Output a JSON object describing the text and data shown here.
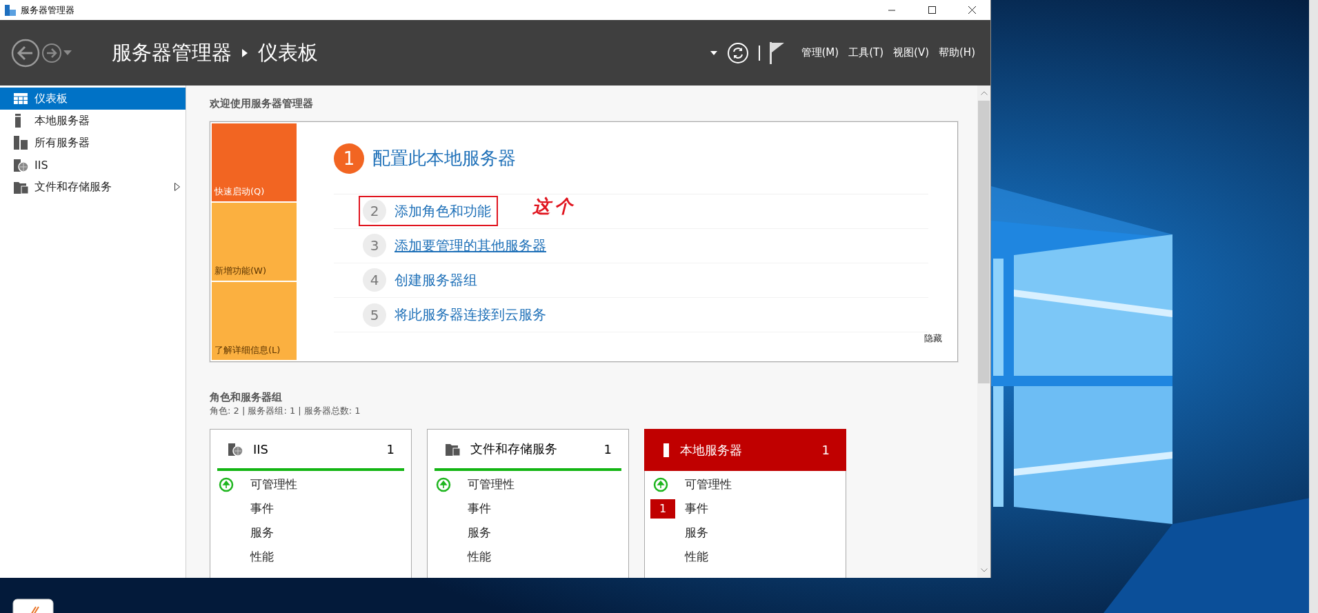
{
  "window": {
    "title": "服务器管理器"
  },
  "header": {
    "breadcrumb": [
      "服务器管理器",
      "仪表板"
    ],
    "menus": [
      "管理(M)",
      "工具(T)",
      "视图(V)",
      "帮助(H)"
    ]
  },
  "sidebar": {
    "items": [
      {
        "label": "仪表板",
        "kind": "dashboard",
        "selected": true,
        "has_children": false
      },
      {
        "label": "本地服务器",
        "kind": "server",
        "selected": false,
        "has_children": false
      },
      {
        "label": "所有服务器",
        "kind": "servers",
        "selected": false,
        "has_children": false
      },
      {
        "label": "IIS",
        "kind": "iis",
        "selected": false,
        "has_children": false
      },
      {
        "label": "文件和存储服务",
        "kind": "files",
        "selected": false,
        "has_children": true
      }
    ]
  },
  "welcome": {
    "heading": "欢迎使用服务器管理器",
    "tiles": [
      {
        "label": "快速启动(Q)",
        "selected": true
      },
      {
        "label": "新增功能(W)",
        "selected": false
      },
      {
        "label": "了解详细信息(L)",
        "selected": false
      }
    ],
    "step": {
      "number": "1",
      "title": "配置此本地服务器"
    },
    "tasks": [
      {
        "number": "2",
        "label": "添加角色和功能",
        "highlighted": true,
        "hovered": false
      },
      {
        "number": "3",
        "label": "添加要管理的其他服务器",
        "highlighted": false,
        "hovered": true
      },
      {
        "number": "4",
        "label": "创建服务器组",
        "highlighted": false,
        "hovered": false
      },
      {
        "number": "5",
        "label": "将此服务器连接到云服务",
        "highlighted": false,
        "hovered": false
      }
    ],
    "annotation": "这个",
    "hide": "隐藏"
  },
  "roles": {
    "heading": "角色和服务器组",
    "summary": "角色: 2 | 服务器组: 1 | 服务器总数: 1",
    "tiles": [
      {
        "name": "IIS",
        "kind": "iis",
        "count": "1",
        "alert": false,
        "rows": [
          {
            "label": "可管理性",
            "healthy": true
          },
          {
            "label": "事件"
          },
          {
            "label": "服务"
          },
          {
            "label": "性能"
          }
        ]
      },
      {
        "name": "文件和存储服务",
        "kind": "files",
        "count": "1",
        "alert": false,
        "rows": [
          {
            "label": "可管理性",
            "healthy": true
          },
          {
            "label": "事件"
          },
          {
            "label": "服务"
          },
          {
            "label": "性能"
          }
        ]
      },
      {
        "name": "本地服务器",
        "kind": "server",
        "count": "1",
        "alert": true,
        "rows": [
          {
            "label": "可管理性",
            "healthy": true
          },
          {
            "label": "事件",
            "badge": "1"
          },
          {
            "label": "服务"
          },
          {
            "label": "性能"
          }
        ]
      }
    ]
  }
}
